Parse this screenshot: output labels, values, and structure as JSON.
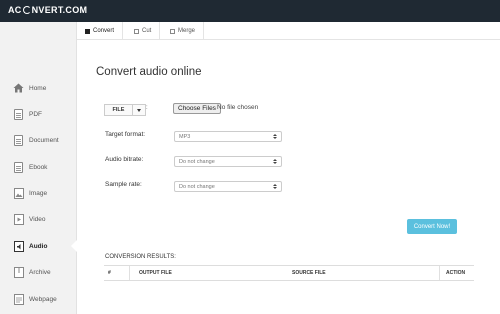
{
  "header": {
    "logo_left": "AC",
    "logo_right": "NVERT.COM"
  },
  "tabs": [
    {
      "label": "Convert",
      "active": true
    },
    {
      "label": "Cut",
      "active": false
    },
    {
      "label": "Merge",
      "active": false
    }
  ],
  "sidebar": {
    "items": [
      {
        "label": "Home",
        "icon": "home-icon"
      },
      {
        "label": "PDF",
        "icon": "pdf-icon"
      },
      {
        "label": "Document",
        "icon": "document-icon"
      },
      {
        "label": "Ebook",
        "icon": "ebook-icon"
      },
      {
        "label": "Image",
        "icon": "image-icon"
      },
      {
        "label": "Video",
        "icon": "video-icon"
      },
      {
        "label": "Audio",
        "icon": "audio-icon",
        "active": true
      },
      {
        "label": "Archive",
        "icon": "archive-icon"
      },
      {
        "label": "Webpage",
        "icon": "webpage-icon"
      }
    ]
  },
  "main": {
    "title": "Convert audio online",
    "file_button": "FILE",
    "colon": ":",
    "choose_files": "Choose Files",
    "no_file": "No file chosen",
    "target_format": {
      "label": "Target format:",
      "value": "MP3"
    },
    "audio_bitrate": {
      "label": "Audio bitrate:",
      "value": "Do not change"
    },
    "sample_rate": {
      "label": "Sample rate:",
      "value": "Do not change"
    },
    "convert_button": "Convert Now!",
    "results": {
      "label": "CONVERSION RESULTS:",
      "columns": [
        "#",
        "OUTPUT FILE",
        "SOURCE FILE",
        "ACTION"
      ]
    }
  },
  "colors": {
    "topbar": "#1f2933",
    "sidebar": "#f2f2f2",
    "accent_button": "#5bc0de"
  }
}
